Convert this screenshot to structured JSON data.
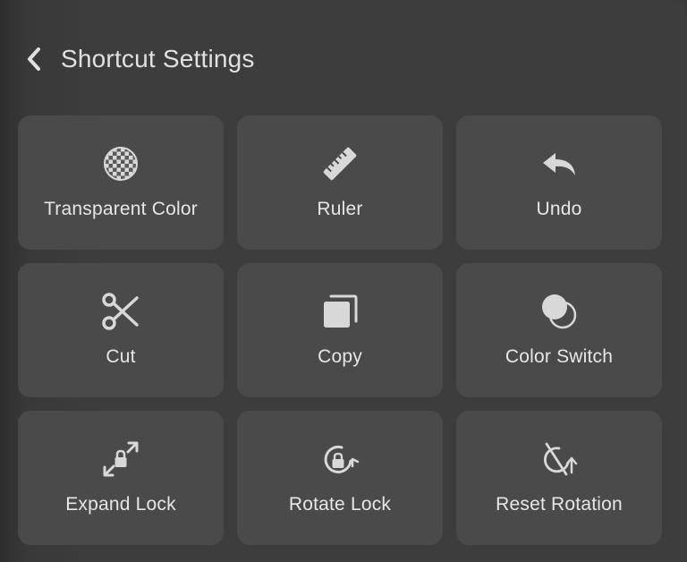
{
  "header": {
    "title": "Shortcut Settings",
    "back_icon": "chevron-left-icon"
  },
  "tiles": [
    {
      "label": "Transparent Color",
      "icon": "transparent-color-icon"
    },
    {
      "label": "Ruler",
      "icon": "ruler-icon"
    },
    {
      "label": "Undo",
      "icon": "undo-icon"
    },
    {
      "label": "Cut",
      "icon": "scissors-icon"
    },
    {
      "label": "Copy",
      "icon": "copy-icon"
    },
    {
      "label": "Color Switch",
      "icon": "color-switch-icon"
    },
    {
      "label": "Expand Lock",
      "icon": "expand-lock-icon"
    },
    {
      "label": "Rotate Lock",
      "icon": "rotate-lock-icon"
    },
    {
      "label": "Reset Rotation",
      "icon": "reset-rotation-icon"
    }
  ],
  "colors": {
    "panel_bg": "#3d3d3d",
    "tile_bg": "#4a4a4a",
    "text": "#e6e6e6",
    "icon": "#d8d8d8"
  }
}
